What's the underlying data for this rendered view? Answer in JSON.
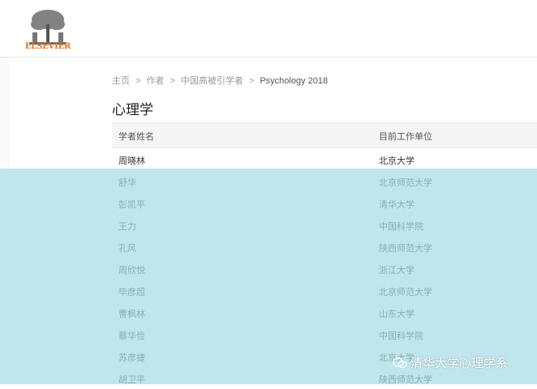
{
  "header": {
    "logo_text": "ELSEVIER",
    "logo_icon": "elsevier-tree-logo"
  },
  "breadcrumb": {
    "items": [
      "主页",
      "作者",
      "中国高被引学者"
    ],
    "current": "Psychology 2018",
    "separator": ">"
  },
  "page_title": "心理学",
  "table": {
    "columns": [
      "学者姓名",
      "目前工作单位"
    ],
    "rows": [
      {
        "name": "周晓林",
        "affiliation": "北京大学"
      },
      {
        "name": "舒华",
        "affiliation": "北京师范大学"
      },
      {
        "name": "彭凯平",
        "affiliation": "清华大学"
      },
      {
        "name": "王力",
        "affiliation": "中国科学院"
      },
      {
        "name": "孔风",
        "affiliation": "陕西师范大学"
      },
      {
        "name": "周欣悦",
        "affiliation": "浙江大学"
      },
      {
        "name": "毕彦超",
        "affiliation": "北京师范大学"
      },
      {
        "name": "曹枫林",
        "affiliation": "山东大学"
      },
      {
        "name": "蔡华俭",
        "affiliation": "中国科学院"
      },
      {
        "name": "苏彦捷",
        "affiliation": "北京大学"
      },
      {
        "name": "胡卫平",
        "affiliation": "陕西师范大学"
      }
    ]
  },
  "watermark": {
    "text": "清华大学心理学系",
    "icon": "wechat-icon"
  },
  "colors": {
    "overlay": "#a9dbe6",
    "logo_orange": "#e9711c",
    "header_bg": "#f5f5f5"
  }
}
